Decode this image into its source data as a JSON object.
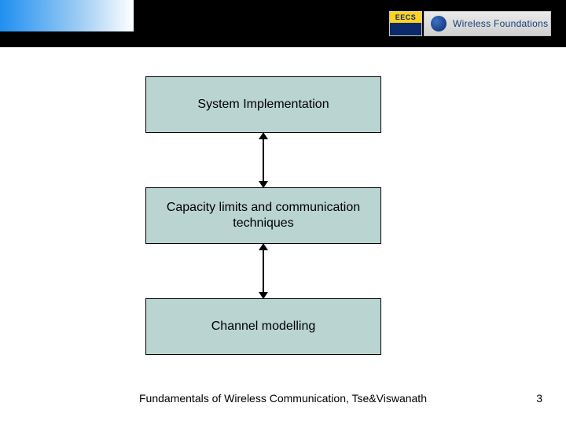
{
  "header": {
    "eecs_label": "EECS",
    "wf_label": "Wireless Foundations"
  },
  "diagram": {
    "boxes": [
      {
        "label": "System Implementation"
      },
      {
        "label": "Capacity limits and communication techniques"
      },
      {
        "label": "Channel modelling"
      }
    ]
  },
  "footer": {
    "title": "Fundamentals of Wireless Communication, Tse&Viswanath",
    "page": "3"
  }
}
